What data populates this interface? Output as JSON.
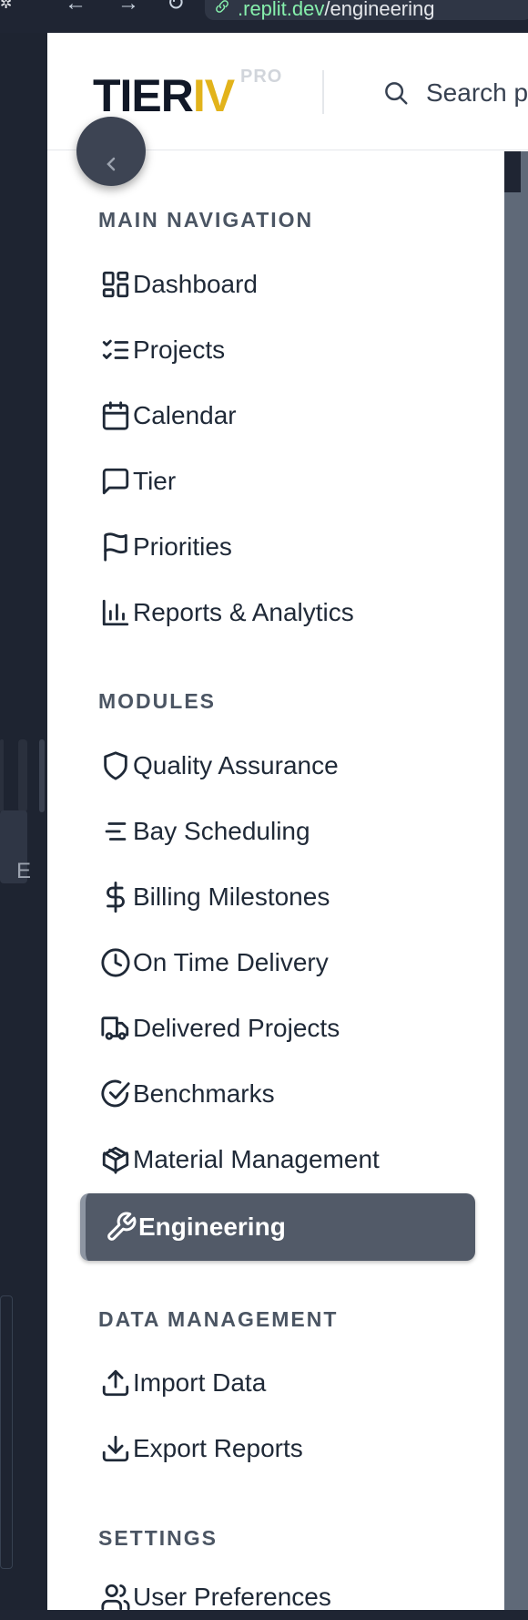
{
  "browser": {
    "url_domain": ".replit.dev",
    "url_path": "/engineering"
  },
  "backdrop": {
    "letter": "E"
  },
  "header": {
    "logo_main": "TIER",
    "logo_accent": "IV",
    "logo_badge": "PRO",
    "search_label": "Search p"
  },
  "sections": {
    "main_navigation": "MAIN NAVIGATION",
    "modules": "MODULES",
    "data_management": "DATA MANAGEMENT",
    "settings": "SETTINGS"
  },
  "nav": {
    "dashboard": "Dashboard",
    "projects": "Projects",
    "calendar": "Calendar",
    "tier": "Tier",
    "priorities": "Priorities",
    "reports": "Reports & Analytics",
    "quality": "Quality Assurance",
    "bay": "Bay Scheduling",
    "billing": "Billing Milestones",
    "ontime": "On Time Delivery",
    "delivered": "Delivered Projects",
    "benchmarks": "Benchmarks",
    "material": "Material Management",
    "engineering": "Engineering",
    "import": "Import Data",
    "export": "Export Reports",
    "preferences": "User Preferences"
  },
  "active_item": "engineering",
  "colors": {
    "accent": "#e2b31b",
    "active_bg": "#525a68",
    "url_domain": "#86efac"
  }
}
